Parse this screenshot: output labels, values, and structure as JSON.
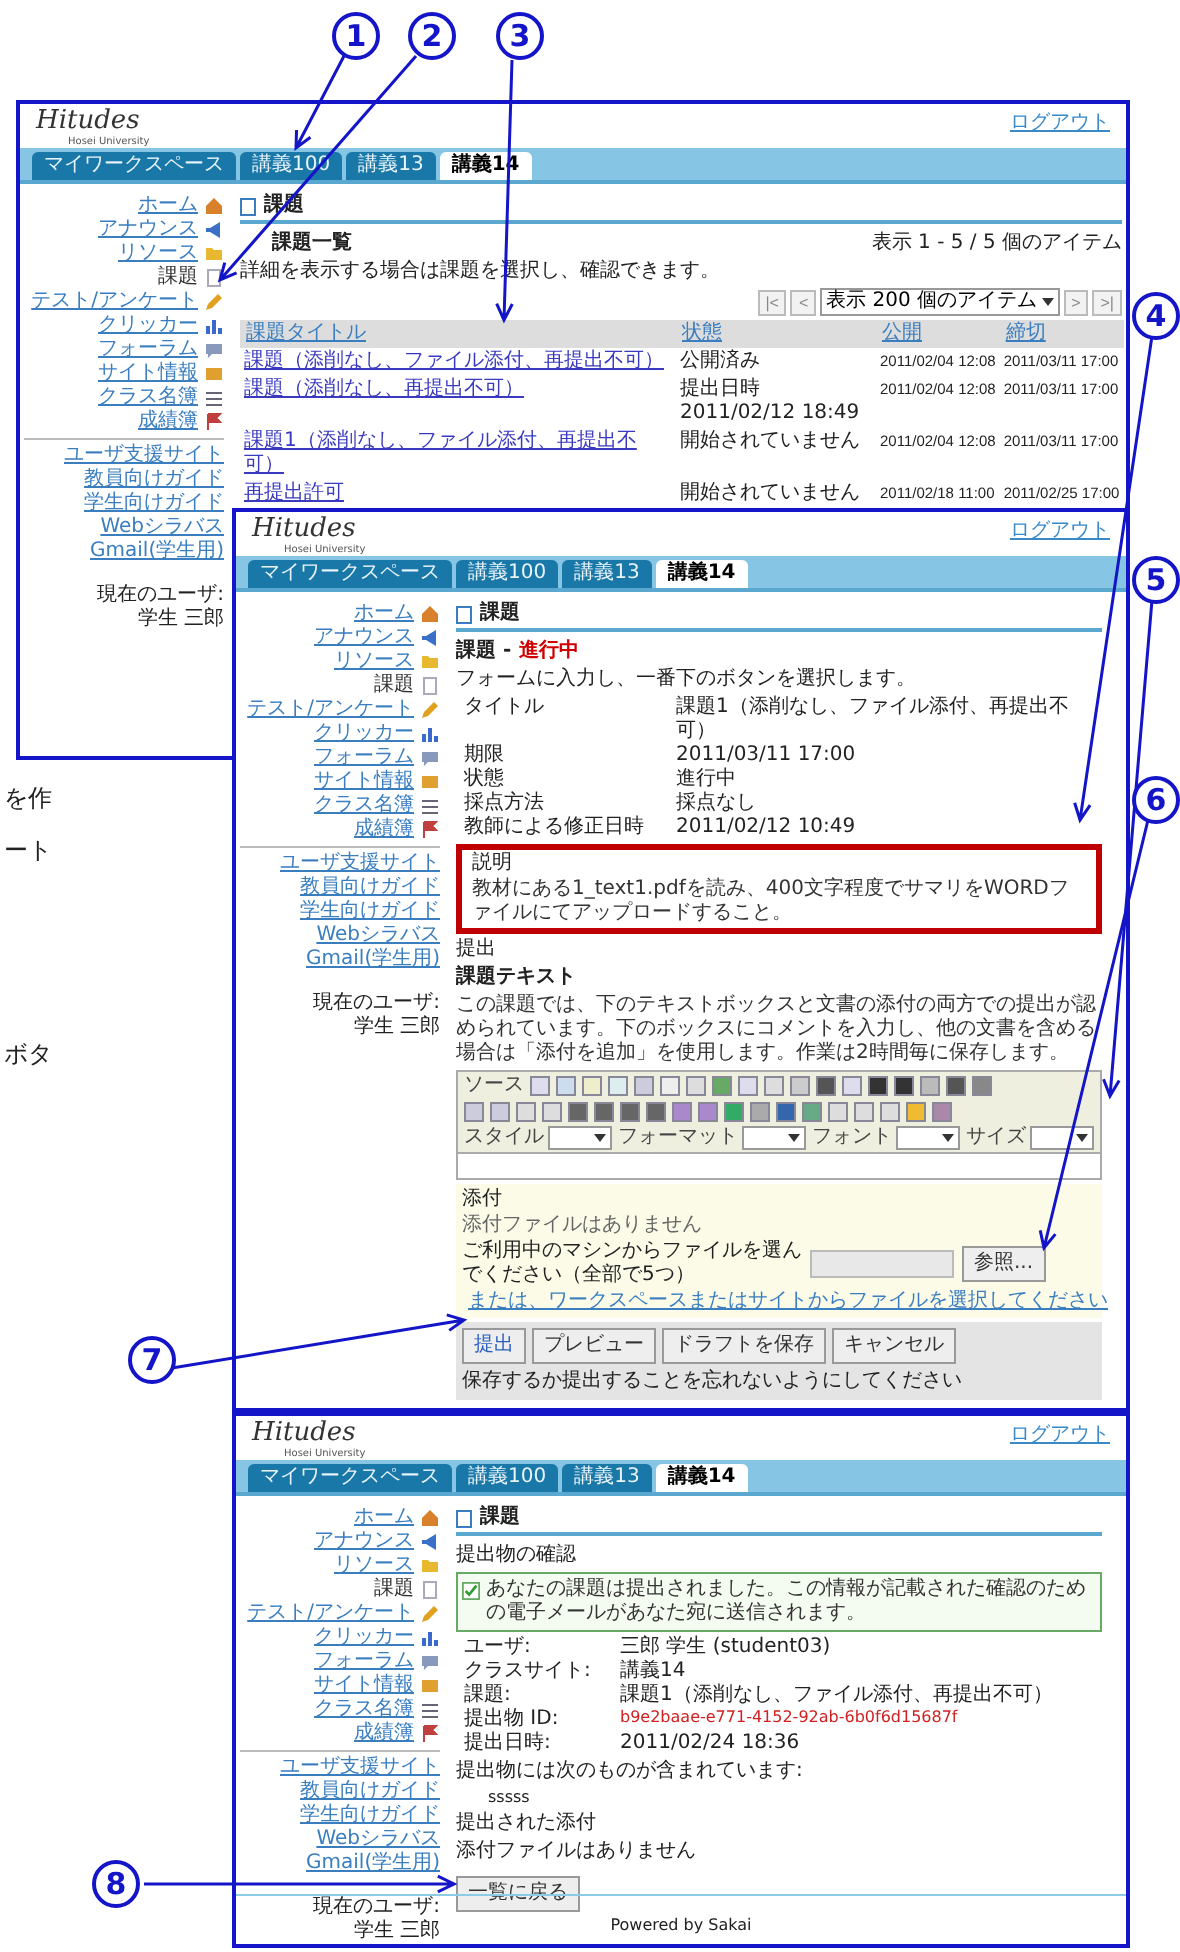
{
  "callouts": [
    {
      "number": "1"
    },
    {
      "number": "2"
    },
    {
      "number": "3"
    },
    {
      "number": "4"
    },
    {
      "number": "5"
    },
    {
      "number": "6"
    },
    {
      "number": "7"
    },
    {
      "number": "8"
    }
  ],
  "page_fragments": [
    "を作",
    "ート",
    "ボタ"
  ],
  "screenshots": [
    {
      "kind": "assignment_list",
      "logo": "Hitudes",
      "logo_sub": "Hosei University",
      "logout": "ログアウト",
      "tabs": [
        {
          "label": "マイワークスペース",
          "selected": false
        },
        {
          "label": "講義100",
          "selected": false
        },
        {
          "label": "講義13",
          "selected": false
        },
        {
          "label": "講義14",
          "selected": true
        }
      ],
      "sidebar": {
        "tools": [
          {
            "kind": "home",
            "label": "ホーム",
            "current": false
          },
          {
            "kind": "announce",
            "label": "アナウンス",
            "current": false
          },
          {
            "kind": "resource",
            "label": "リソース",
            "current": false
          },
          {
            "kind": "assignment",
            "label": "課題",
            "current": true
          },
          {
            "kind": "test",
            "label": "テスト/アンケート",
            "current": false
          },
          {
            "kind": "clicker",
            "label": "クリッカー",
            "current": false
          },
          {
            "kind": "forum",
            "label": "フォーラム",
            "current": false
          },
          {
            "kind": "siteinfo",
            "label": "サイト情報",
            "current": false
          },
          {
            "kind": "roster",
            "label": "クラス名簿",
            "current": false
          },
          {
            "kind": "gradebook",
            "label": "成績簿",
            "current": false
          }
        ],
        "links": [
          "ユーザ支援サイト",
          "教員向けガイド",
          "学生向けガイド",
          "Webシラバス",
          "Gmail(学生用)"
        ],
        "user_label": "現在のユーザ:",
        "user_name": "学生 三郎"
      },
      "tool_title": "課題",
      "list_title": "課題一覧",
      "instruction": "詳細を表示する場合は課題を選択し、確認できます。",
      "item_count": "表示 1 - 5 / 5 個のアイテム",
      "pager": {
        "first": "|<",
        "prev": "<",
        "page_size": "表示 200 個のアイテム",
        "next": ">",
        "last": ">|"
      },
      "table": {
        "columns": [
          "課題タイトル",
          "状態",
          "公開",
          "締切"
        ],
        "rows": [
          [
            "課題（添削なし、ファイル添付、再提出不可）",
            "公開済み",
            "2011/02/04 12:08",
            "2011/03/11 17:00"
          ],
          [
            "課題（添削なし、再提出不可）",
            "提出日時 2011/02/12 18:49",
            "2011/02/04 12:08",
            "2011/03/11 17:00"
          ],
          [
            "課題1（添削なし、ファイル添付、再提出不可）",
            "開始されていません",
            "2011/02/04 12:08",
            "2011/03/11 17:00"
          ],
          [
            "再提出許可",
            "開始されていません",
            "2011/02/18 11:00",
            "2011/02/25 17:00"
          ]
        ]
      }
    },
    {
      "kind": "assignment_form",
      "logo": "Hitudes",
      "logo_sub": "Hosei University",
      "logout": "ログアウト",
      "tabs": [
        {
          "label": "マイワークスペース",
          "selected": false
        },
        {
          "label": "講義100",
          "selected": false
        },
        {
          "label": "講義13",
          "selected": false
        },
        {
          "label": "講義14",
          "selected": true
        }
      ],
      "sidebar": {
        "tools": [
          {
            "kind": "home",
            "label": "ホーム",
            "current": false
          },
          {
            "kind": "announce",
            "label": "アナウンス",
            "current": false
          },
          {
            "kind": "resource",
            "label": "リソース",
            "current": false
          },
          {
            "kind": "assignment",
            "label": "課題",
            "current": true
          },
          {
            "kind": "test",
            "label": "テスト/アンケート",
            "current": false
          },
          {
            "kind": "clicker",
            "label": "クリッカー",
            "current": false
          },
          {
            "kind": "forum",
            "label": "フォーラム",
            "current": false
          },
          {
            "kind": "siteinfo",
            "label": "サイト情報",
            "current": false
          },
          {
            "kind": "roster",
            "label": "クラス名簿",
            "current": false
          },
          {
            "kind": "gradebook",
            "label": "成績簿",
            "current": false
          }
        ],
        "links": [
          "ユーザ支援サイト",
          "教員向けガイド",
          "学生向けガイド",
          "Webシラバス",
          "Gmail(学生用)"
        ],
        "user_label": "現在のユーザ:",
        "user_name": "学生 三郎"
      },
      "tool_title": "課題",
      "form_title": "課題 - ",
      "form_status": "進行中",
      "instruction": "フォームに入力し、一番下のボタンを選択します。",
      "details": [
        [
          "タイトル",
          "課題1（添削なし、ファイル添付、再提出不可）"
        ],
        [
          "期限",
          "2011/03/11 17:00"
        ],
        [
          "状態",
          "進行中"
        ],
        [
          "採点方法",
          "採点なし"
        ],
        [
          "教師による修正日時",
          "2011/02/12 10:49"
        ]
      ],
      "description": {
        "label": "説明",
        "text": "教材にある1_text1.pdfを読み、400文字程度でサマリをWORDファイルにてアップロードすること。"
      },
      "submission": {
        "heading": "提出",
        "text_label": "課題テキスト",
        "guidance": "この課題では、下のテキストボックスと文書の添付の両方での提出が認められています。下のボックスにコメントを入力し、他の文書を含める場合は「添付を追加」を使用します。作業は2時間毎に保存します。"
      },
      "editor": {
        "source": "ソース",
        "fields": [
          "スタイル",
          "フォーマット",
          "フォント",
          "サイズ"
        ]
      },
      "attachments": {
        "heading": "添付",
        "empty": "添付ファイルはありません",
        "chooser_label": "ご利用中のマシンからファイルを選んでください（全部で5つ）",
        "browse": "参照...",
        "workspace_link": "または、ワークスペースまたはサイトからファイルを選択してください"
      },
      "buttons": [
        {
          "label": "提出",
          "primary": true
        },
        {
          "label": "プレビュー",
          "primary": false
        },
        {
          "label": "ドラフトを保存",
          "primary": false
        },
        {
          "label": "キャンセル",
          "primary": false
        }
      ],
      "note": "保存するか提出することを忘れないようにしてください"
    },
    {
      "kind": "confirmation",
      "logo": "Hitudes",
      "logo_sub": "Hosei University",
      "logout": "ログアウト",
      "tabs": [
        {
          "label": "マイワークスペース",
          "selected": false
        },
        {
          "label": "講義100",
          "selected": false
        },
        {
          "label": "講義13",
          "selected": false
        },
        {
          "label": "講義14",
          "selected": true
        }
      ],
      "sidebar": {
        "tools": [
          {
            "kind": "home",
            "label": "ホーム",
            "current": false
          },
          {
            "kind": "announce",
            "label": "アナウンス",
            "current": false
          },
          {
            "kind": "resource",
            "label": "リソース",
            "current": false
          },
          {
            "kind": "assignment",
            "label": "課題",
            "current": true
          },
          {
            "kind": "test",
            "label": "テスト/アンケート",
            "current": false
          },
          {
            "kind": "clicker",
            "label": "クリッカー",
            "current": false
          },
          {
            "kind": "forum",
            "label": "フォーラム",
            "current": false
          },
          {
            "kind": "siteinfo",
            "label": "サイト情報",
            "current": false
          },
          {
            "kind": "roster",
            "label": "クラス名簿",
            "current": false
          },
          {
            "kind": "gradebook",
            "label": "成績簿",
            "current": false
          }
        ],
        "links": [
          "ユーザ支援サイト",
          "教員向けガイド",
          "学生向けガイド",
          "Webシラバス",
          "Gmail(学生用)"
        ],
        "user_label": "現在のユーザ:",
        "user_name": "学生 三郎"
      },
      "tool_title": "課題",
      "confirm_title": "提出物の確認",
      "success": "あなたの課題は提出されました。この情報が記載された確認のための電子メールがあなた宛に送信されます。",
      "details": [
        {
          "label": "ユーザ:",
          "value": "三郎 学生 (student03)",
          "kind": "text"
        },
        {
          "label": "クラスサイト:",
          "value": "講義14",
          "kind": "text"
        },
        {
          "label": "課題:",
          "value": "課題1（添削なし、ファイル添付、再提出不可）",
          "kind": "text"
        },
        {
          "label": "提出物 ID:",
          "value": "b9e2baae-e771-4152-92ab-6b0f6d15687f",
          "kind": "id"
        },
        {
          "label": "提出日時:",
          "value": "2011/02/24 18:36",
          "kind": "text"
        }
      ],
      "contents_label": "提出物には次のものが含まれています:",
      "contents": "sssss",
      "attached_label": "提出された添付",
      "attached": "添付ファイルはありません",
      "back": "一覧に戻る",
      "footer": "Powered by Sakai"
    }
  ]
}
